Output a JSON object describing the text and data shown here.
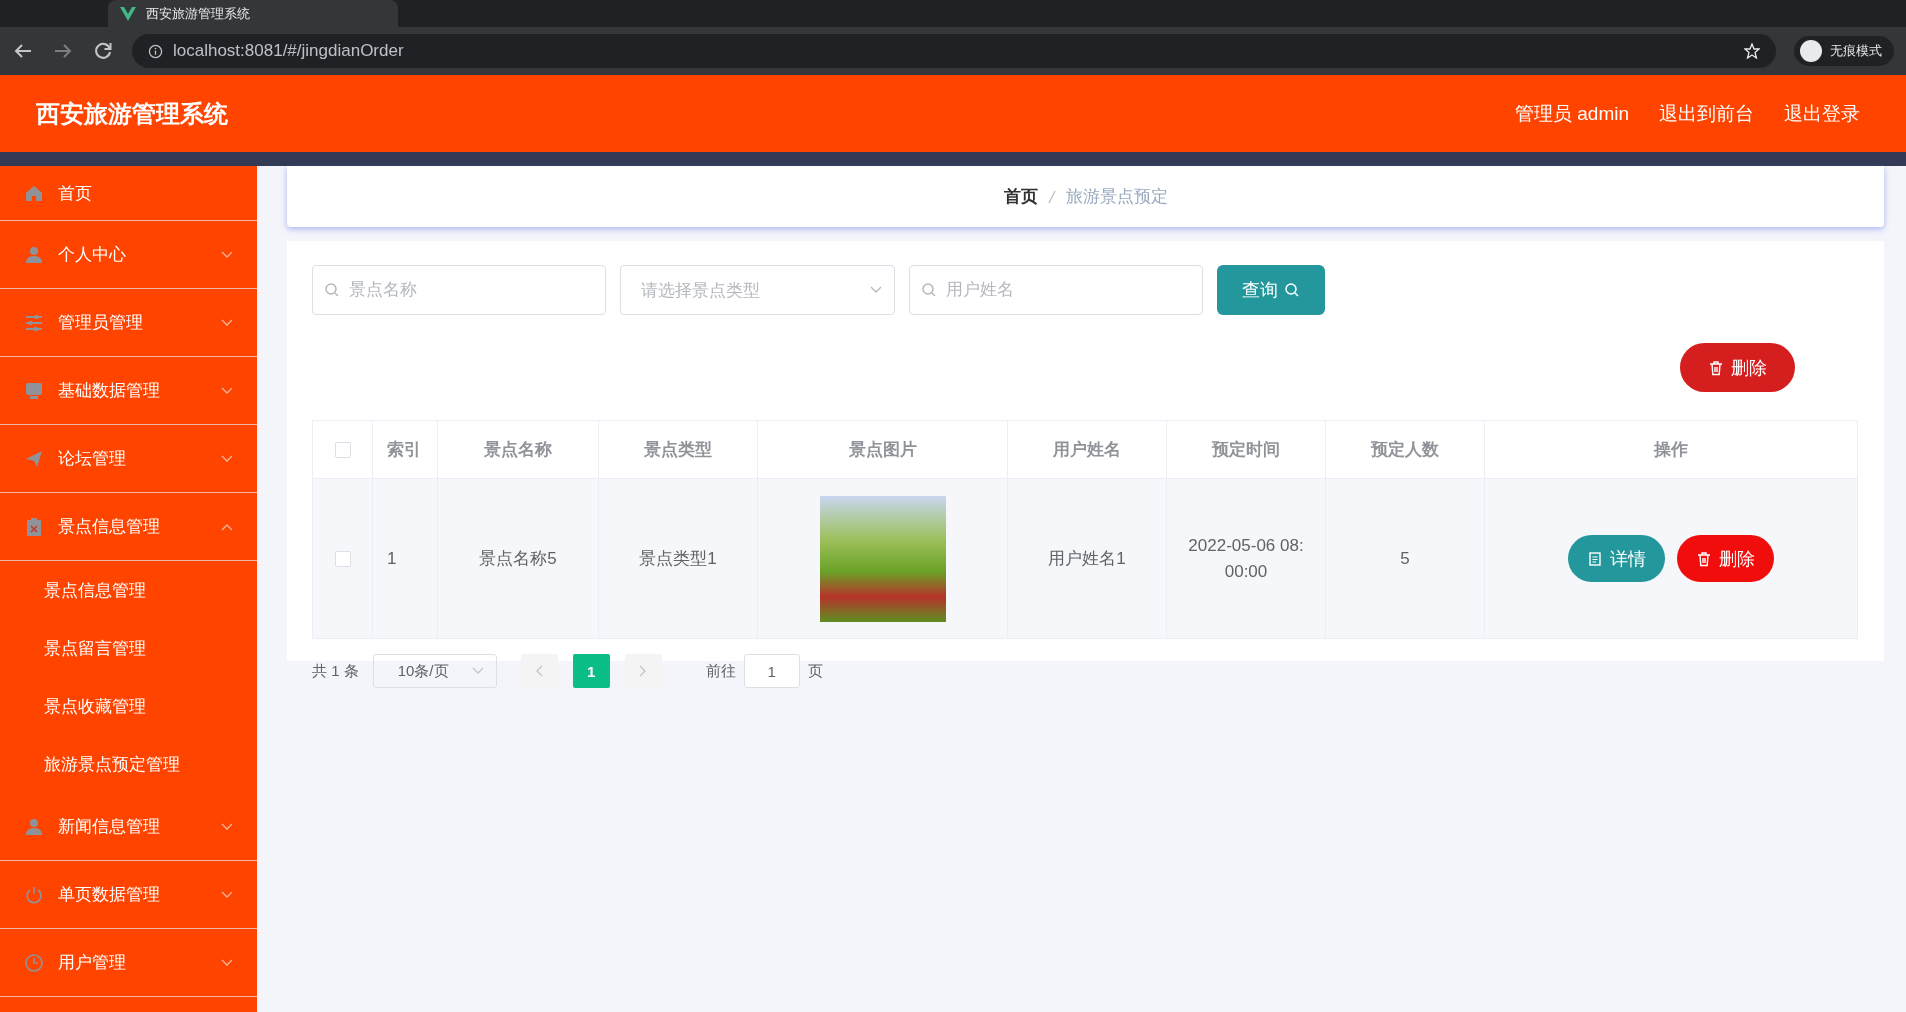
{
  "browser": {
    "tabs": [
      {
        "title": "西安旅游管理系统",
        "selected": true
      }
    ],
    "url": "localhost:8081/#/jingdianOrder",
    "profile_label": "无痕模式"
  },
  "header": {
    "title": "西安旅游管理系统",
    "links": [
      "管理员 admin",
      "退出到前台",
      "退出登录"
    ]
  },
  "sidebar": {
    "items": [
      {
        "label": "首页"
      },
      {
        "label": "个人中心",
        "expanded": false
      },
      {
        "label": "管理员管理",
        "expanded": false
      },
      {
        "label": "基础数据管理",
        "expanded": false
      },
      {
        "label": "论坛管理",
        "expanded": false
      },
      {
        "label": "景点信息管理",
        "expanded": true,
        "children": [
          "景点信息管理",
          "景点留言管理",
          "景点收藏管理",
          "旅游景点预定管理"
        ]
      },
      {
        "label": "新闻信息管理",
        "expanded": false
      },
      {
        "label": "单页数据管理",
        "expanded": false
      },
      {
        "label": "用户管理",
        "expanded": false
      }
    ]
  },
  "breadcrumb": [
    "首页",
    "旅游景点预定"
  ],
  "search": {
    "fields": [
      {
        "kind": "input",
        "placeholder": "景点名称"
      },
      {
        "kind": "select",
        "placeholder": "请选择景点类型"
      },
      {
        "kind": "input",
        "placeholder": "用户姓名"
      }
    ],
    "button": "查询"
  },
  "delete_button": "删除",
  "table": {
    "header_checked": false,
    "columns": [
      "索引",
      "景点名称",
      "景点类型",
      "景点图片",
      "用户姓名",
      "预定时间",
      "预定人数",
      "操作"
    ],
    "rows": [
      {
        "checked": false,
        "cells": [
          "1",
          "景点名称5",
          "景点类型1",
          "",
          "用户姓名1",
          "2022-05-06 08:00:00",
          "5"
        ],
        "actions": [
          "详情",
          "删除"
        ]
      }
    ]
  },
  "pagination": {
    "total": "共 1 条",
    "page_size": "10条/页",
    "pages": [
      {
        "label": "1",
        "selected": true
      }
    ],
    "goto_label": "前往",
    "goto_value": "1",
    "goto_suffix": "页"
  }
}
